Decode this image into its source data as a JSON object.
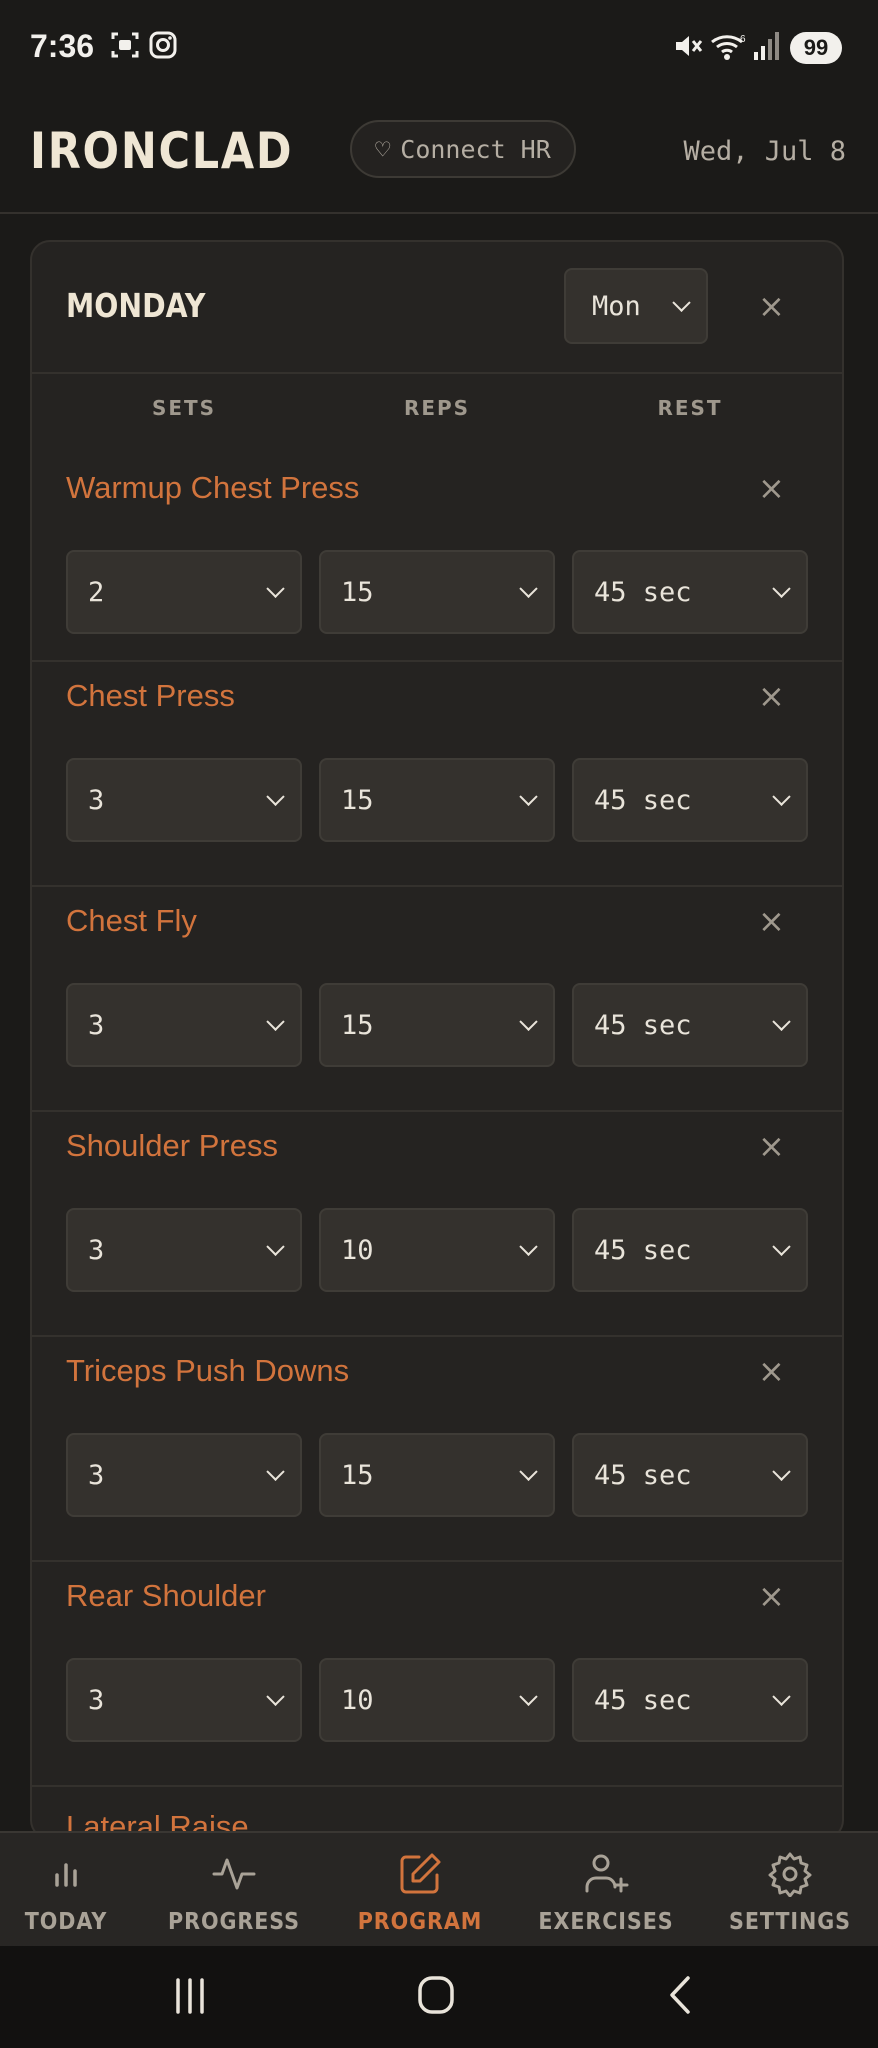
{
  "status_bar": {
    "time": "7:36",
    "battery": "99"
  },
  "header": {
    "title": "IRONCLAD",
    "connect_label": "Connect HR",
    "date": "Wed, Jul 8"
  },
  "day_card": {
    "day_title": "MONDAY",
    "day_select_value": "Mon",
    "columns": {
      "sets": "SETS",
      "reps": "REPS",
      "rest": "REST"
    },
    "exercises": [
      {
        "name": "Warmup Chest Press",
        "sets": "2",
        "reps": "15",
        "rest": "45 sec"
      },
      {
        "name": "Chest Press",
        "sets": "3",
        "reps": "15",
        "rest": "45 sec"
      },
      {
        "name": "Chest Fly",
        "sets": "3",
        "reps": "15",
        "rest": "45 sec"
      },
      {
        "name": "Shoulder Press",
        "sets": "3",
        "reps": "10",
        "rest": "45 sec"
      },
      {
        "name": "Triceps Push Downs",
        "sets": "3",
        "reps": "15",
        "rest": "45 sec"
      },
      {
        "name": "Rear Shoulder",
        "sets": "3",
        "reps": "10",
        "rest": "45 sec"
      }
    ],
    "partial_exercise": "Lateral Raise"
  },
  "nav": {
    "items": [
      {
        "label": "TODAY",
        "icon": "bar-chart-icon"
      },
      {
        "label": "PROGRESS",
        "icon": "activity-icon"
      },
      {
        "label": "PROGRAM",
        "icon": "edit-icon"
      },
      {
        "label": "EXERCISES",
        "icon": "user-plus-icon"
      },
      {
        "label": "SETTINGS",
        "icon": "gear-icon"
      }
    ],
    "active": "PROGRAM"
  },
  "colors": {
    "accent": "#d2743d",
    "background": "#1b1a18",
    "card": "#252321"
  }
}
